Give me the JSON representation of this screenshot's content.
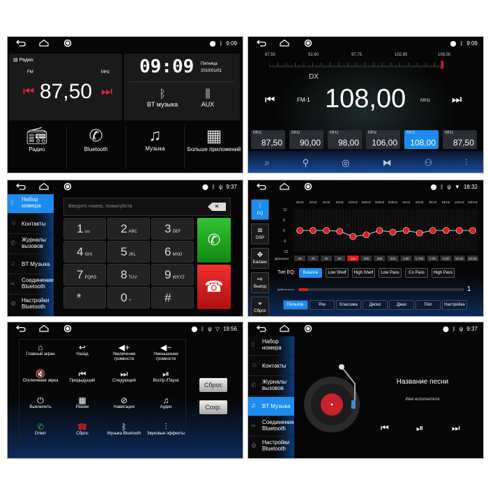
{
  "status": {
    "time_1": "9:09",
    "time_2": "9:09",
    "time_3": "9:37",
    "time_4": "18:32",
    "time_5": "19:56",
    "time_6": "9:37"
  },
  "home": {
    "radio_title": "Радио",
    "band": "FM",
    "unit": "MHz",
    "frequency": "87,50",
    "clock": "09:09",
    "weekday": "Пятница",
    "date": "2010/01/01",
    "bt_music": "BT музыка",
    "aux": "AUX",
    "apps": [
      {
        "label": "Радио",
        "icon": "radio-icon"
      },
      {
        "label": "Bluetooth",
        "icon": "phone-icon"
      },
      {
        "label": "Музыка",
        "icon": "music-note-icon"
      },
      {
        "label": "Больше приложений",
        "icon": "apps-grid-icon"
      }
    ]
  },
  "radio": {
    "scale": [
      "87,50",
      "92,60",
      "97,75",
      "102,85",
      "108,00"
    ],
    "scale_range": [
      87.5,
      108.0
    ],
    "mode": "DX",
    "band": "FM-1",
    "frequency": "108,00",
    "unit": "MHz",
    "accent": "#1b8cf0",
    "presets": [
      {
        "unit": "MHz",
        "value": "87,50"
      },
      {
        "unit": "MHz",
        "value": "90,00"
      },
      {
        "unit": "MHz",
        "value": "98,00"
      },
      {
        "unit": "MHz",
        "value": "106,00"
      },
      {
        "unit": "MHz",
        "value": "108,00",
        "active": true
      },
      {
        "unit": "MHz",
        "value": "87,50"
      }
    ],
    "tools": [
      "scan-icon",
      "search-icon",
      "antenna-icon",
      "stereo-icon",
      "local-icon",
      "equalizer-icon"
    ]
  },
  "phone": {
    "sidebar": [
      "Набор номера",
      "Контакты",
      "Журналы вызовов",
      "BT Музыка",
      "Соединение Bluetooth",
      "Настройки Bluetooth"
    ],
    "placeholder": "Введите номер, пожалуйста",
    "keys": [
      {
        "d": "1",
        "l": "ᴑᴑ"
      },
      {
        "d": "2",
        "l": "ABC"
      },
      {
        "d": "3",
        "l": "DEF"
      },
      {
        "d": "4",
        "l": "GHI"
      },
      {
        "d": "5",
        "l": "JKL"
      },
      {
        "d": "6",
        "l": "MNO"
      },
      {
        "d": "7",
        "l": "PQRS"
      },
      {
        "d": "8",
        "l": "TUV"
      },
      {
        "d": "9",
        "l": "WXYZ"
      },
      {
        "d": "*",
        "l": ""
      },
      {
        "d": "0",
        "l": "+"
      },
      {
        "d": "#",
        "l": ""
      }
    ],
    "call_color": "#1fa01f",
    "hangup_color": "#e01b1b"
  },
  "eq": {
    "sidebar": [
      "EQ",
      "DSP",
      "Баланс",
      "Вывод",
      "Сброс"
    ],
    "bands": [
      "20HZ",
      "30HZ",
      "40HZ",
      "50HZ",
      "100HZ",
      "200HZ",
      "300HZ",
      "500HZ",
      "1KHZ",
      "2KHZ",
      "3KHZ",
      "5KHZ",
      "10KHZ",
      "20KHZ"
    ],
    "y_ticks": [
      "12",
      "6",
      "0",
      "-6",
      "-12"
    ],
    "y_range": [
      -12,
      12
    ],
    "values": [
      0,
      0,
      0,
      -0.5,
      -3.5,
      -2.5,
      0,
      -1,
      0,
      -1.5,
      0,
      0,
      0,
      0
    ],
    "range_label": "Диапазон",
    "ranges": [
      "20",
      "30",
      "40",
      "50",
      "115",
      "206",
      "300",
      "525",
      "1.0K",
      "1.73K",
      "3.0K",
      "5.0K",
      "10.0K",
      "20.0K"
    ],
    "selected_band": 4,
    "type_label": "Тип EQ:",
    "types": [
      "Balance",
      "Low Shelf",
      "High Shelf",
      "Low Pass",
      "Co Pass",
      "High Pass"
    ],
    "q_label": "Добротность",
    "q_value": "1",
    "q_fraction": 0.06,
    "presets": [
      "Пользов.",
      "Рок",
      "Классика",
      "Диско",
      "Джаз",
      "Поп",
      "Настройка"
    ]
  },
  "wheel": {
    "items": [
      {
        "label": "Главный экран",
        "g": "⌂"
      },
      {
        "label": "Назад",
        "g": "↩"
      },
      {
        "label": "Увеличение громкости",
        "g": "◀+"
      },
      {
        "label": "Уменьшение громкости",
        "g": "◀−"
      },
      {
        "label": "Отключение звука",
        "g": "🔇"
      },
      {
        "label": "Предыдущий",
        "g": "⏮"
      },
      {
        "label": "Следующий",
        "g": "⏭"
      },
      {
        "label": "Воспр./Пауза",
        "g": "⏯"
      },
      {
        "label": "Выключить",
        "g": "⏻"
      },
      {
        "label": "Режим",
        "g": "▦"
      },
      {
        "label": "Навигация",
        "g": "⊘"
      },
      {
        "label": "Аудио",
        "g": "♫"
      },
      {
        "label": "Ответ",
        "g": "✆"
      },
      {
        "label": "Сброс",
        "g": "☎"
      },
      {
        "label": "Музыка Bluetooth",
        "g": "ᛒ"
      },
      {
        "label": "Звуковые эффекты",
        "g": "⫶"
      }
    ],
    "reset": "Сброс",
    "save": "Сохр."
  },
  "btmusic": {
    "sidebar": [
      "Набор номера",
      "Контакты",
      "Журналы вызовов",
      "BT Музыка",
      "Соединение Bluetooth",
      "Настройки Bluetooth"
    ],
    "song": "Название песни",
    "artist": "Имя исполнителя"
  }
}
